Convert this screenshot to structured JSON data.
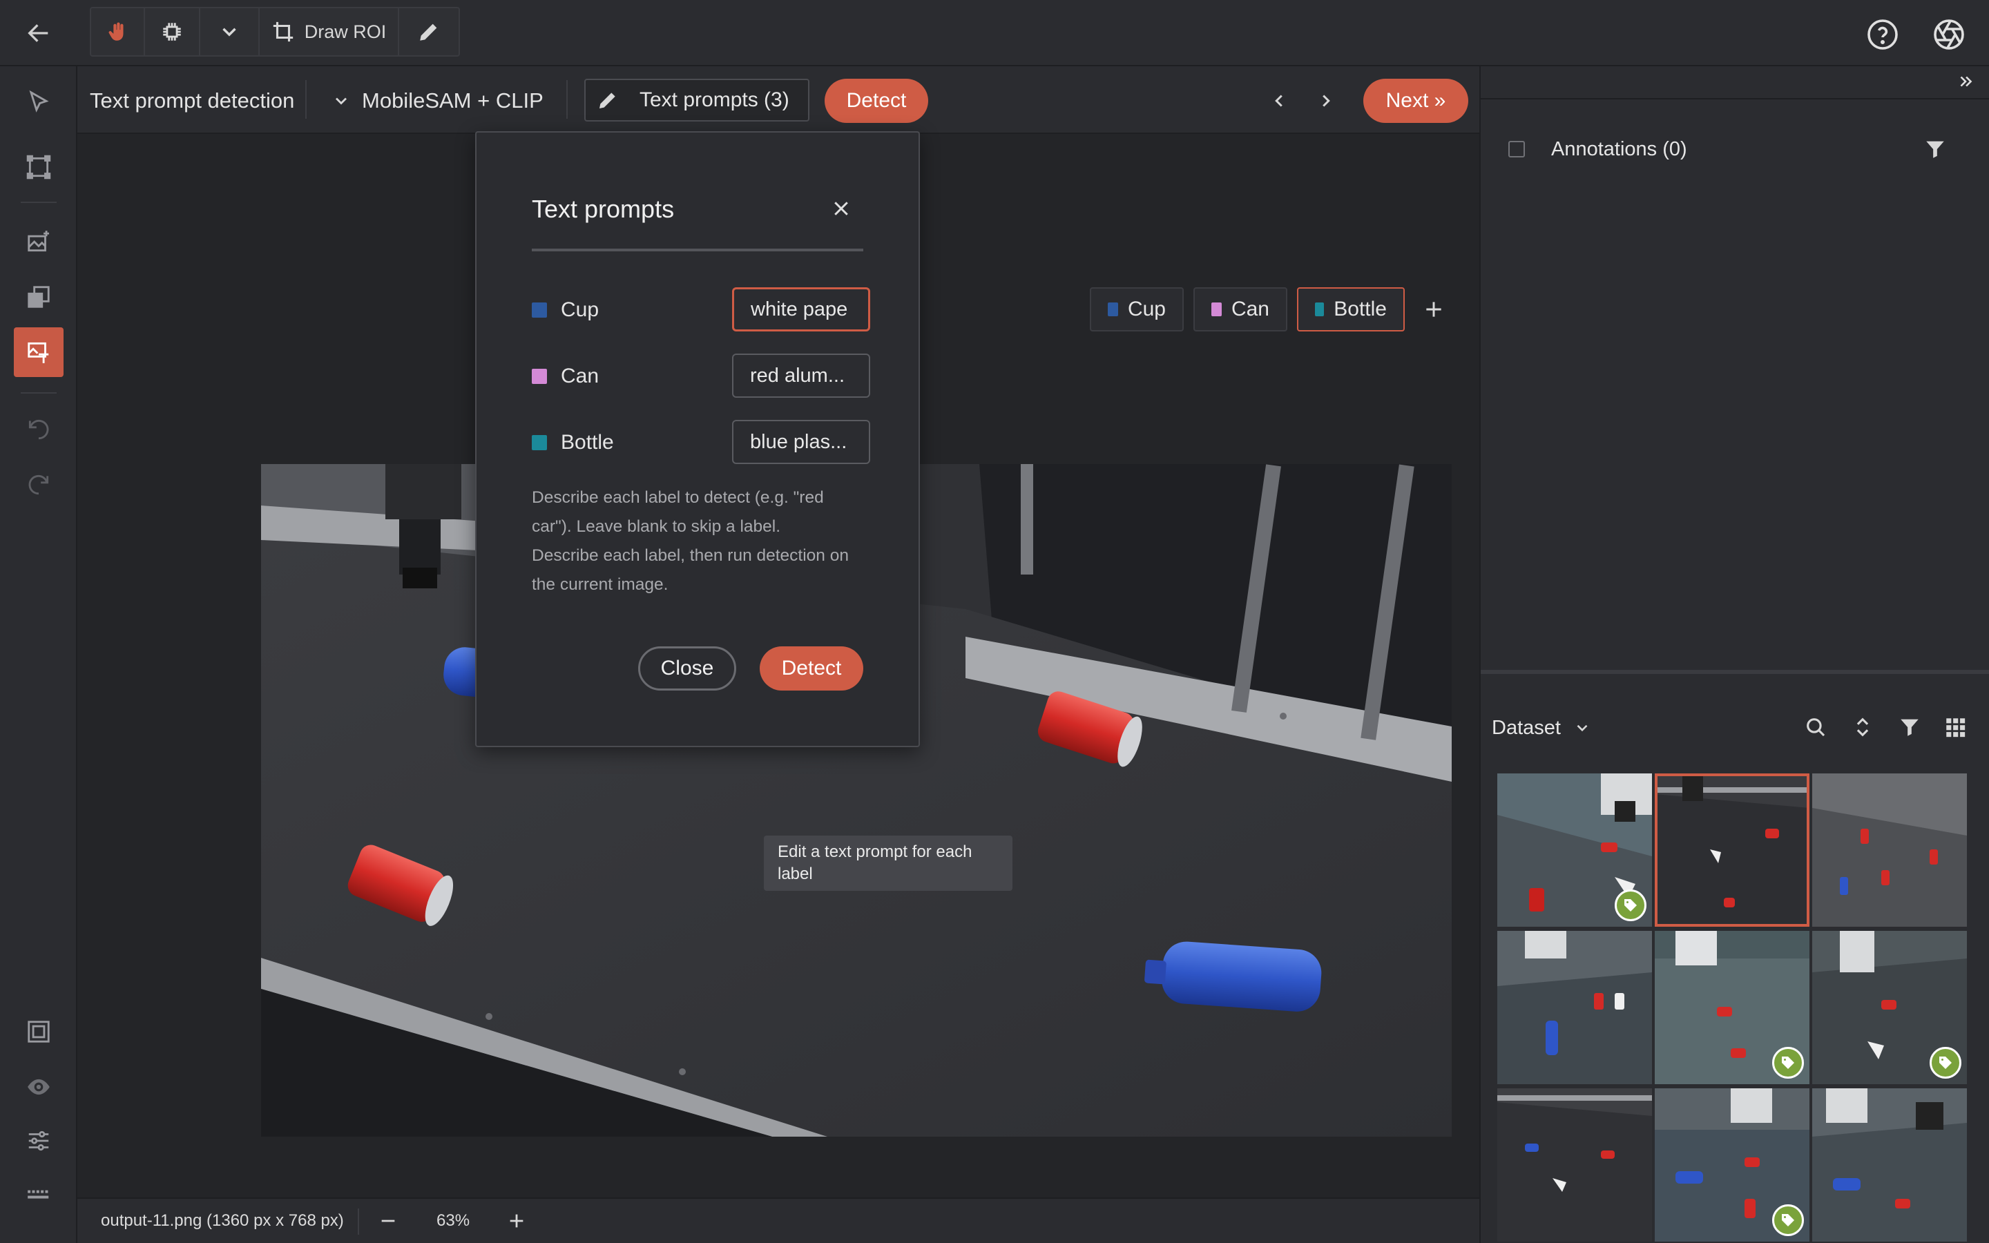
{
  "toolbar": {
    "draw_roi_label": "Draw ROI"
  },
  "sub_toolbar": {
    "mode_title": "Text prompt detection",
    "model_name": "MobileSAM + CLIP",
    "text_prompts_button": "Text prompts (3)",
    "detect_button": "Detect",
    "next_button": "Next »"
  },
  "labels": [
    {
      "name": "Cup",
      "color": "#2d5aa0"
    },
    {
      "name": "Can",
      "color": "#d48ad6"
    },
    {
      "name": "Bottle",
      "color": "#1b8a9a"
    }
  ],
  "modal": {
    "title": "Text prompts",
    "prompts": [
      {
        "label": "Cup",
        "value": "white pape",
        "color": "#2d5aa0"
      },
      {
        "label": "Can",
        "value": "red alum...",
        "color": "#d48ad6"
      },
      {
        "label": "Bottle",
        "value": "blue plas...",
        "color": "#1b8a9a"
      }
    ],
    "help_text": "Describe each label to detect (e.g. \"red car\"). Leave blank to skip a label.",
    "help_text_2": "Describe each label, then run detection on the current image.",
    "close_button": "Close",
    "detect_button": "Detect",
    "tooltip": "Edit a text prompt for each label"
  },
  "status": {
    "file_info": "output-11.png (1360 px x 768 px)",
    "zoom": "63%"
  },
  "right_panel": {
    "annotations_title": "Annotations (0)",
    "dataset_label": "Dataset"
  },
  "colors": {
    "accent": "#cf5c45",
    "tag_green": "#7aa23b"
  }
}
